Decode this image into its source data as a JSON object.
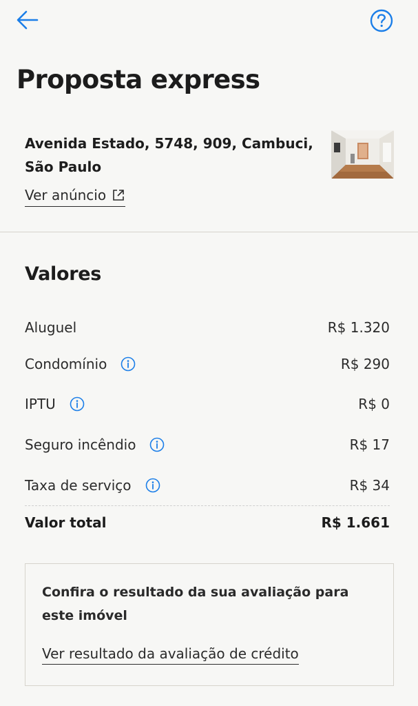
{
  "header": {
    "back_icon": "arrow-left-icon",
    "help_icon": "question-circle-icon",
    "accent_color": "#1b7ee8"
  },
  "page": {
    "title": "Proposta express"
  },
  "listing": {
    "address_line1": "Avenida Estado, 5748, 909, Cambuci,",
    "address_line2": "São Paulo",
    "view_ad_label": "Ver anúncio",
    "view_ad_icon": "external-link-icon"
  },
  "values": {
    "title": "Valores",
    "items": [
      {
        "label": "Aluguel",
        "value": "R$ 1.320",
        "info": false
      },
      {
        "label": "Condomínio",
        "value": "R$ 290",
        "info": true
      },
      {
        "label": "IPTU",
        "value": "R$ 0",
        "info": true
      },
      {
        "label": "Seguro incêndio",
        "value": "R$ 17",
        "info": true
      },
      {
        "label": "Taxa de serviço",
        "value": "R$ 34",
        "info": true
      }
    ],
    "total": {
      "label": "Valor total",
      "value": "R$ 1.661"
    }
  },
  "credit_card": {
    "text": "Confira o resultado da sua avaliação para este imóvel",
    "link_label": "Ver resultado da avaliação de crédito"
  }
}
